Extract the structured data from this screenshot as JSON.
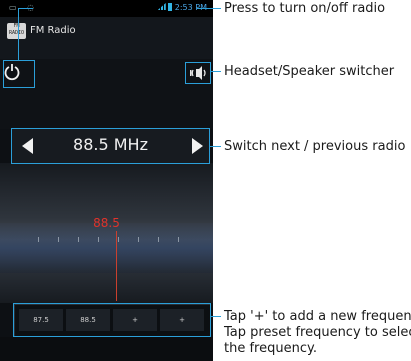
{
  "status": {
    "time": "2:53 PM"
  },
  "app": {
    "title": "FM Radio",
    "icon_text_top": "FM",
    "icon_text_bottom": "RADIO"
  },
  "tuner": {
    "frequency": "88.5 MHz",
    "dial_reading": "88.5"
  },
  "presets": [
    "87.5",
    "88.5",
    "+",
    "+"
  ],
  "annotations": {
    "power": "Press to turn on/off radio",
    "speaker": "Headset/Speaker switcher",
    "switch": "Switch next / previous radio",
    "preset_line1": "Tap '+' to add a new frequency;",
    "preset_line2": "Tap preset frequency to select",
    "preset_line3": "the frequency."
  },
  "colors": {
    "accent": "#2b9fd9",
    "needle": "#c9402e",
    "reading": "#e0332b"
  }
}
